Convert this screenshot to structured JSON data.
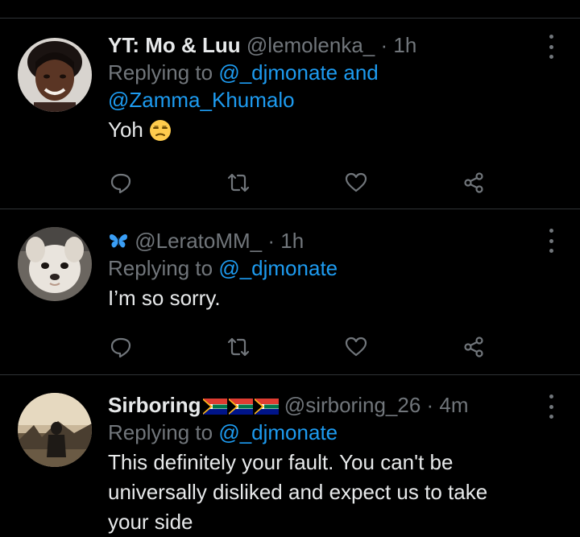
{
  "tweets": [
    {
      "name": "YT: Mo & Luu",
      "handle": "@lemolenka_",
      "time": "· 1h",
      "replying_prefix": "Replying to",
      "mention1": "@_djmonate",
      "and_text": "and",
      "mention2": "@Zamma_Khumalo",
      "text": "Yoh",
      "emoji_icon": "unamused-face-icon"
    },
    {
      "name_icon": "butterfly-icon",
      "handle": "@LeratoMM_",
      "time": "· 1h",
      "replying_prefix": "Replying to",
      "mention1": "@_djmonate",
      "text": "I’m so sorry."
    },
    {
      "name": "Sirboring",
      "flag_icons": [
        "south-africa-flag-icon",
        "south-africa-flag-icon",
        "south-africa-flag-icon"
      ],
      "handle": "@sirboring_26",
      "time": "· 4m",
      "replying_prefix": "Replying to",
      "mention1": "@_djmonate",
      "text_line1": "This definitely your fault. You can't be",
      "text_line2": "universally disliked and expect us to take",
      "text_line3": "your side"
    }
  ],
  "colors": {
    "background": "#000000",
    "primary_text": "#e7e9ea",
    "secondary_text": "#71767b",
    "link": "#1d9bf0",
    "divider": "#2f3336"
  }
}
